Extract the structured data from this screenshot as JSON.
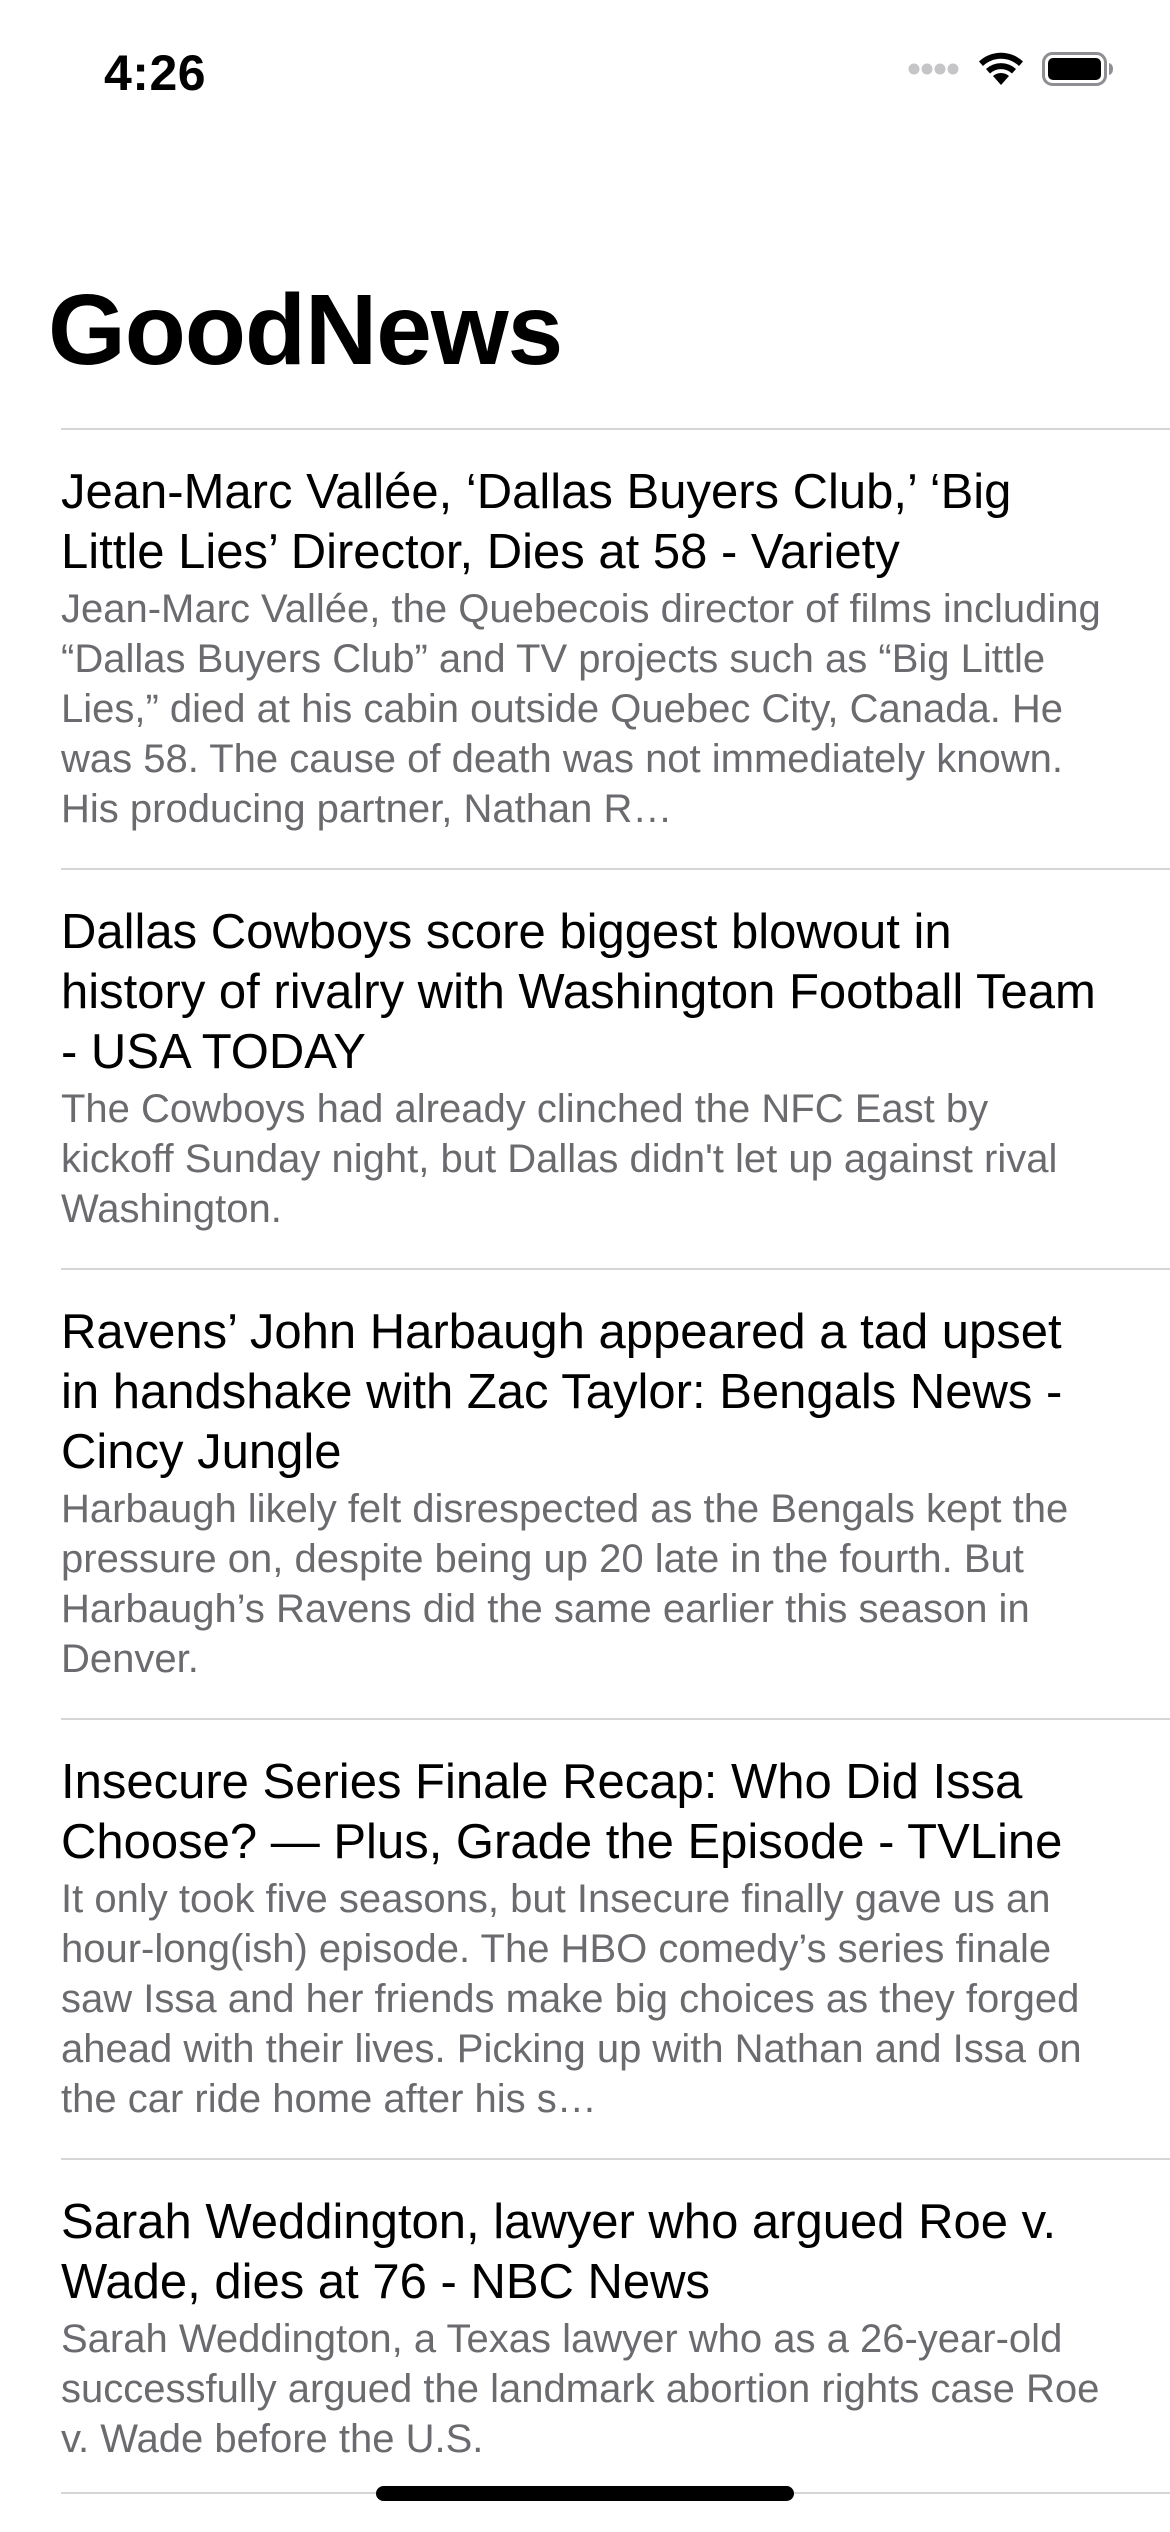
{
  "status_bar": {
    "time": "4:26",
    "icons": [
      "cellular-signal-icon",
      "wifi-icon",
      "battery-icon"
    ]
  },
  "nav": {
    "title": "GoodNews"
  },
  "articles": [
    {
      "title": "Jean-Marc Vallée, ‘Dallas Buyers Club,’ ‘Big Little Lies’ Director, Dies at 58 - Variety",
      "description": "Jean-Marc Vallée, the Quebecois director of films including “Dallas Buyers Club” and TV projects such as “Big Little Lies,” died at his cabin outside Quebec City, Canada. He was 58. The cause of death was not immediately known. His producing partner, Nathan R…"
    },
    {
      "title": "Dallas Cowboys score biggest blowout in history of rivalry with Washington Football Team - USA TODAY",
      "description": "The Cowboys had already clinched the NFC East by kickoff Sunday night, but Dallas didn't let up against rival Washington."
    },
    {
      "title": "Ravens’ John Harbaugh appeared a tad upset in handshake with Zac Taylor: Bengals News - Cincy Jungle",
      "description": "Harbaugh likely felt disrespected as the Bengals kept the pressure on, despite being up 20 late in the fourth. But Harbaugh’s Ravens did the same earlier this season in Denver."
    },
    {
      "title": "Insecure Series Finale Recap: Who Did Issa Choose? — Plus, Grade the Episode - TVLine",
      "description": "It only took five seasons, but Insecure finally gave us an hour-long(ish) episode. The HBO comedy’s series finale saw Issa and her friends make big choices as they forged ahead with their lives. Picking up with Nathan and Issa on the car ride home after his s…"
    },
    {
      "title": "Sarah Weddington, lawyer who argued Roe v. Wade, dies at 76 - NBC News",
      "description": "Sarah Weddington, a Texas lawyer who as a 26-year-old successfully argued the landmark abortion rights case Roe v. Wade before the U.S."
    }
  ]
}
